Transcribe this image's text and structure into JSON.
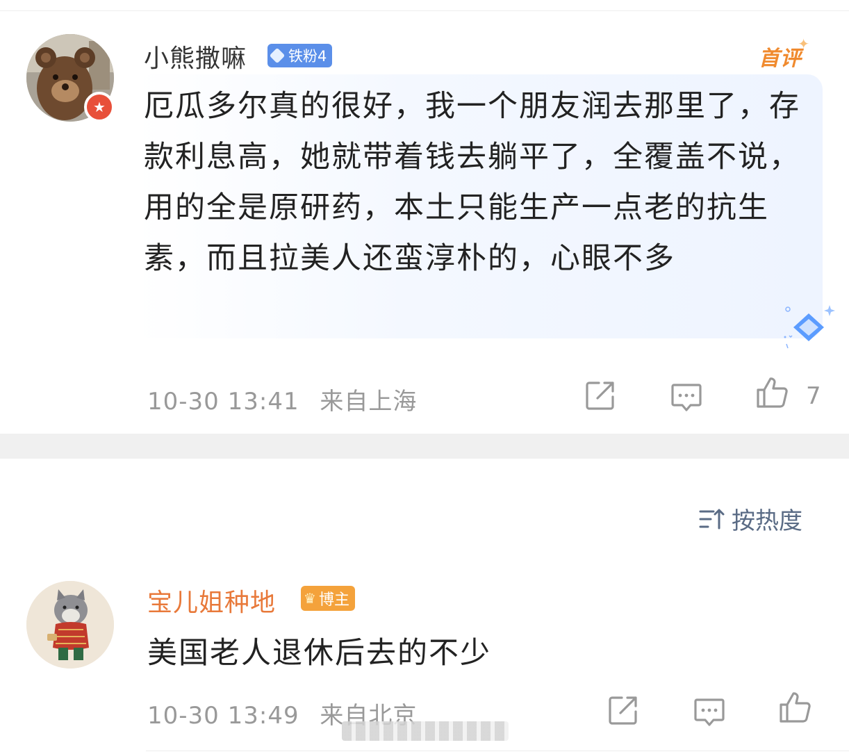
{
  "main_comment": {
    "username": "小熊撒嘛",
    "fan_badge": "铁粉4",
    "first_comment_tag": "首评",
    "content": "厄瓜多尔真的很好，我一个朋友润去那里了，存款利息高，她就带着钱去躺平了，全覆盖不说，用的全是原研药，本土只能生产一点老的抗生素，而且拉美人还蛮淳朴的，心眼不多",
    "time": "10-30 13:41",
    "location": "来自上海",
    "likes": "7"
  },
  "sort": {
    "label": "按热度",
    "icon": "sort-icon"
  },
  "reply": {
    "username": "宝儿姐种地",
    "badge": "博主",
    "content": "美国老人退休后去的不少",
    "time": "10-30 13:49",
    "location": "来自北京"
  },
  "colors": {
    "accent_blue": "#5b8fe9",
    "blogger_orange": "#e8793a",
    "meta_gray": "#999999",
    "divider": "#f0f0f0"
  }
}
